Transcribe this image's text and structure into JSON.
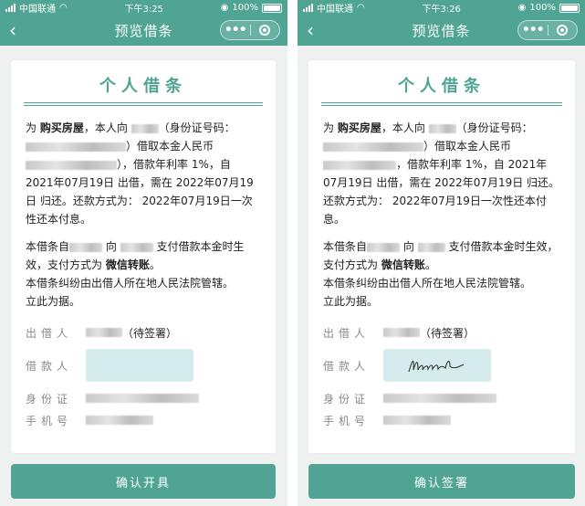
{
  "status": {
    "carrier": "中国联通",
    "battery": "100%"
  },
  "left": {
    "time": "下午3:25",
    "nav_title": "预览借条",
    "doc_title": "个人借条",
    "p1": [
      "为 ",
      "购买房屋",
      "，本人向 ",
      "（身份证号码：",
      "）借取本金人民币",
      "），借款年利率 1%，自 2021年07月19日 出借，需在 2022年07月19日 归还。还款方式为： 2022年07月19日一次性还本付息",
      "。"
    ],
    "p2": [
      "本借条自",
      " 向 ",
      " 支付借款本金时生效，支付方式为 ",
      "微信转账",
      "。"
    ],
    "p3": "本借条纠纷由出借人所在地人民法院管辖。",
    "p4": "立此为据。",
    "lender_label": "出借人",
    "lender_status": "（待签署）",
    "borrower_label": "借款人",
    "id_label": "身份证",
    "phone_label": "手机号",
    "button": "确认开具"
  },
  "right": {
    "time": "下午3:26",
    "nav_title": "预览借条",
    "doc_title": "个人借条",
    "p1": [
      "为 ",
      "购买房屋",
      "，本人向 ",
      "（身份证号码：",
      "）借取本金人民币",
      "，借款年利率 1%，自 2021年07月19日 出借，需在 2022年07月19日 归还。还款方式为： 2022年07月19日一次性还本付息",
      "。"
    ],
    "p2": [
      "本借条自",
      " 向 ",
      " 支付借款本金时生效，支付方式为 ",
      "微信转账",
      "。"
    ],
    "p3": "本借条纠纷由出借人所在地人民法院管辖。",
    "p4": "立此为据。",
    "lender_label": "出借人",
    "lender_status": "（待签署）",
    "borrower_label": "借款人",
    "id_label": "身份证",
    "phone_label": "手机号",
    "button": "确认签署"
  },
  "colors": {
    "accent": "#4fa493",
    "sign_box": "#d6ecec",
    "background": "#eef1f0"
  }
}
